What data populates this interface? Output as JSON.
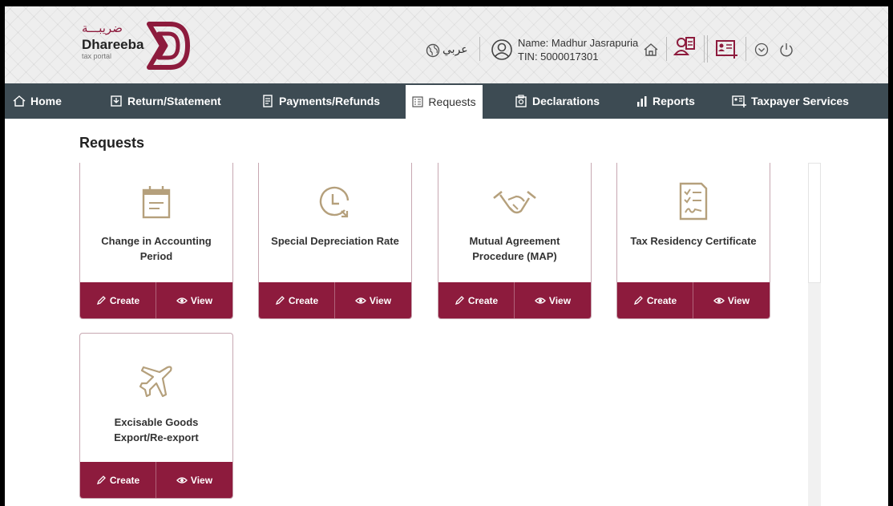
{
  "header": {
    "logo_arabic": "ضريبـــة",
    "logo_name": "Dhareeba",
    "logo_sub": "tax portal",
    "language": "عربي",
    "user_name": "Name: Madhur Jasrapuria",
    "user_tin": "TIN: 5000017301"
  },
  "nav": {
    "items": [
      {
        "label": "Home",
        "icon": "home-icon"
      },
      {
        "label": "Return/Statement",
        "icon": "return-icon"
      },
      {
        "label": "Payments/Refunds",
        "icon": "payments-icon"
      },
      {
        "label": "Requests",
        "icon": "requests-icon"
      },
      {
        "label": "Declarations",
        "icon": "declarations-icon"
      },
      {
        "label": "Reports",
        "icon": "reports-icon"
      },
      {
        "label": "Taxpayer Services",
        "icon": "taxpayer-services-icon"
      }
    ],
    "active": "Requests"
  },
  "page": {
    "title": "Requests"
  },
  "cards": [
    {
      "label": "Change in Accounting Period",
      "icon": "calendar-icon",
      "create": "Create",
      "view": "View"
    },
    {
      "label": "Special Depreciation Rate",
      "icon": "clock-arrow-icon",
      "create": "Create",
      "view": "View"
    },
    {
      "label": "Mutual Agreement Procedure (MAP)",
      "icon": "handshake-icon",
      "create": "Create",
      "view": "View"
    },
    {
      "label": "Tax Residency Certificate",
      "icon": "checklist-icon",
      "create": "Create",
      "view": "View"
    },
    {
      "label": "Excisable Goods Export/Re-export",
      "icon": "airplane-icon",
      "create": "Create",
      "view": "View"
    }
  ],
  "colors": {
    "brand": "#8d1b3d",
    "nav_bg": "#3d4b53",
    "icon_gold": "#b5a07c"
  }
}
